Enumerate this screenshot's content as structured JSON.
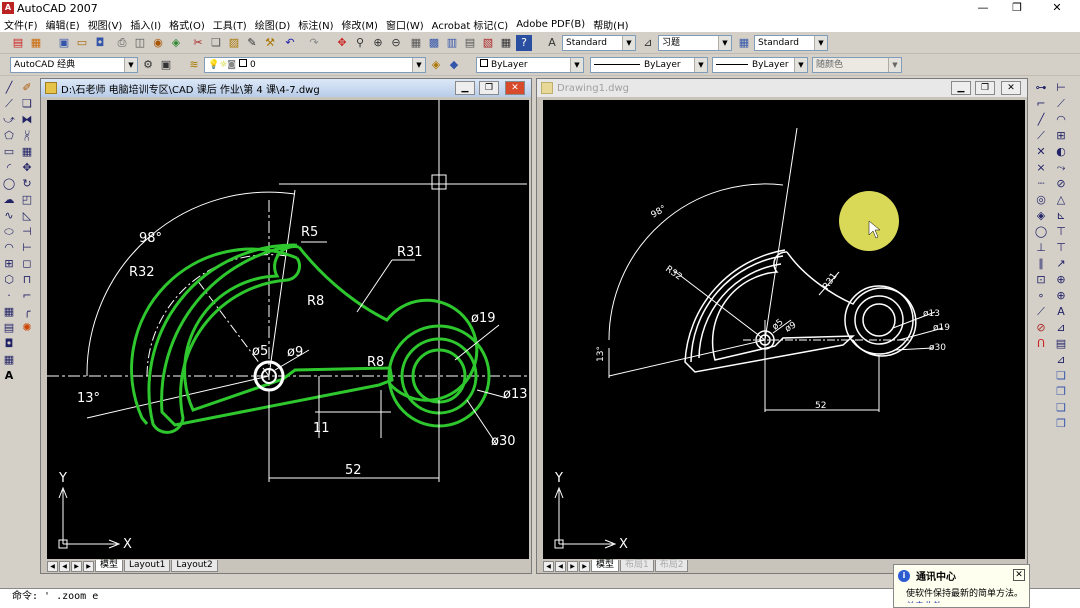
{
  "app": {
    "title": "AutoCAD 2007",
    "icon_label": "A"
  },
  "window_controls": {
    "minimize": "—",
    "restore": "❐",
    "close": "✕"
  },
  "menu": [
    "文件(F)",
    "编辑(E)",
    "视图(V)",
    "插入(I)",
    "格式(O)",
    "工具(T)",
    "绘图(D)",
    "标注(N)",
    "修改(M)",
    "窗口(W)",
    "Acrobat 标记(C)",
    "Adobe PDF(B)",
    "帮助(H)"
  ],
  "toolbar1": {
    "text_style": "Standard",
    "dim_style": "习题",
    "table_style": "Standard"
  },
  "toolbar2": {
    "workspace": "AutoCAD 经典",
    "layer": "0",
    "color": "ByLayer",
    "linetype": "ByLayer",
    "lineweight": "ByLayer",
    "plotstyle": "随颜色"
  },
  "doc1": {
    "title": "D:\\石老师 电脑培训专区\\CAD 课后 作业\\第 4 课\\4-7.dwg",
    "tabs": [
      "模型",
      "Layout1",
      "Layout2"
    ],
    "dims": {
      "angle98": "98°",
      "r5": "R5",
      "r32": "R32",
      "r31": "R31",
      "r8a": "R8",
      "r8b": "R8",
      "d5": "ø5",
      "d9": "ø9",
      "d19": "ø19",
      "d13": "ø13",
      "d30": "ø30",
      "a13": "13°",
      "l11": "11",
      "l52": "52"
    },
    "ucs": {
      "x": "X",
      "y": "Y"
    }
  },
  "doc2": {
    "title": "Drawing1.dwg",
    "tabs": [
      "模型",
      "布局1",
      "布局2"
    ],
    "dims": {
      "angle98": "98°",
      "r32": "R32",
      "r31": "R31",
      "d5": "ø5",
      "d9": "ø9",
      "d13": "ø13",
      "d19": "ø19",
      "d30": "ø30",
      "a13": "13°",
      "l52": "52"
    },
    "ucs": {
      "x": "X",
      "y": "Y"
    }
  },
  "command_line": "命令: ' .zoom  e",
  "notification": {
    "title": "通讯中心",
    "text": "使软件保持最新的简单方法。",
    "text2": "单击此处"
  },
  "colors": {
    "drawing_green": "#2ec82e",
    "canvas_bg": "#000000",
    "highlight": "#ffff66"
  }
}
